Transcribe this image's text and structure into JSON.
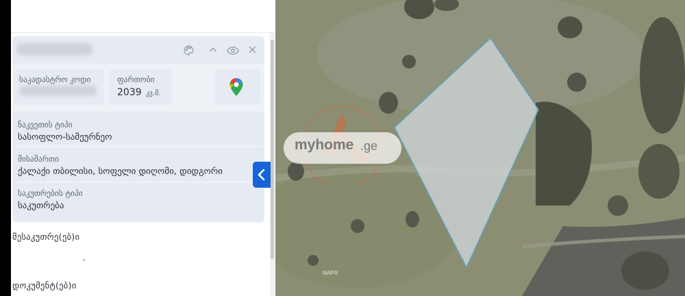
{
  "panel": {
    "cadastral_code_label": "საკადასტრო კოდი",
    "area_label": "ფართობი",
    "area_value": "2039",
    "area_unit": "კვ.მ.",
    "parcel_type_label": "ნაკვეთის ტიპი",
    "parcel_type_value": "სასოფლო-სამეურნეო",
    "address_label": "მისამართი",
    "address_value": "ქალაქი თბილისი, სოფელი დიღომი, დიდგორი",
    "ownership_type_label": "საკუთრების ტიპი",
    "ownership_type_value": "საკუთრება",
    "owners_heading": "მესაკუთრე(ებ)ი",
    "documents_heading": "დოკუმენტ(ებ)ი",
    "header_icons": [
      "palette-icon",
      "chevron-up-icon",
      "eye-icon",
      "close-icon"
    ],
    "maps_icon": "google-maps-pin-icon"
  },
  "map": {
    "watermark_text": "myhome",
    "watermark_domain": ".ge",
    "attribution": "NAPR",
    "collapse_icon": "chevron-left-icon"
  },
  "colors": {
    "accent": "#1565d8",
    "parcel_fill": "#c9d1d4",
    "parcel_stroke": "#5aa7c9",
    "watermark_orange": "#f05a28"
  }
}
